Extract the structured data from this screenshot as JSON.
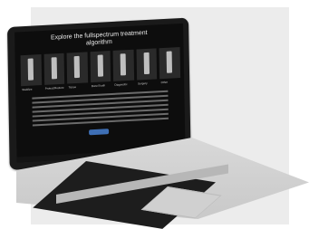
{
  "screen": {
    "title": "Explore the fullspectrum treatment algorithm",
    "tiles": [
      {
        "label": "Stabilize"
      },
      {
        "label": "Protect/Restore"
      },
      {
        "label": "Tissue"
      },
      {
        "label": "Bone/Tooth"
      },
      {
        "label": "Diagnostic"
      },
      {
        "label": "Surgery"
      },
      {
        "label": "Other"
      }
    ]
  }
}
